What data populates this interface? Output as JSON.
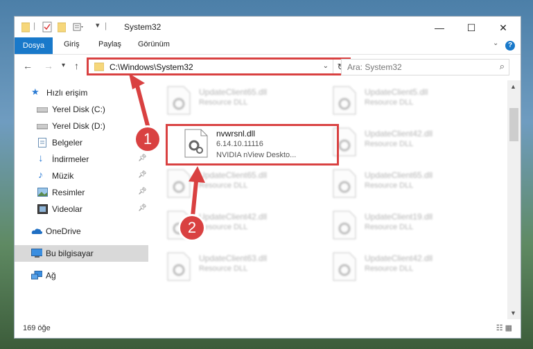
{
  "window": {
    "title": "System32"
  },
  "ribbon": {
    "file_tab": "Dosya",
    "tabs": [
      "Giriş",
      "Paylaş",
      "Görünüm"
    ],
    "help": "?"
  },
  "navigation": {
    "address": "C:\\Windows\\System32",
    "search_placeholder": "Ara: System32"
  },
  "sidebar": {
    "items": [
      {
        "label": "Hızlı erişim",
        "icon": "star-icon"
      },
      {
        "label": "Yerel Disk (C:)",
        "icon": "drive-icon"
      },
      {
        "label": "Yerel Disk (D:)",
        "icon": "drive-icon"
      },
      {
        "label": "Belgeler",
        "icon": "documents-icon",
        "pinned": true
      },
      {
        "label": "İndirmeler",
        "icon": "download-icon",
        "pinned": true
      },
      {
        "label": "Müzik",
        "icon": "music-icon",
        "pinned": true
      },
      {
        "label": "Resimler",
        "icon": "pictures-icon",
        "pinned": true
      },
      {
        "label": "Videolar",
        "icon": "videos-icon",
        "pinned": true
      },
      {
        "label": "OneDrive",
        "icon": "cloud-icon"
      },
      {
        "label": "Bu bilgisayar",
        "icon": "computer-icon",
        "selected": true
      },
      {
        "label": "Ağ",
        "icon": "network-icon"
      }
    ]
  },
  "files": {
    "highlighted": {
      "name": "nvwrsnl.dll",
      "version": "6.14.10.11116",
      "description": "NVIDIA nView Deskto..."
    },
    "blurred": [
      {
        "name": "UpdateClient65.dll",
        "type": "Resource DLL"
      },
      {
        "name": "UpdateClient5.dll",
        "type": "Resource DLL"
      },
      {
        "name": "UpdateClient42.dll",
        "type": "Resource DLL"
      },
      {
        "name": "UpdateClient65.dll",
        "type": "Resource DLL"
      },
      {
        "name": "UpdateClient65.dll",
        "type": "Resource DLL"
      },
      {
        "name": "UpdateClient42.dll",
        "type": "Resource DLL"
      },
      {
        "name": "UpdateClient19.dll",
        "type": "Resource DLL"
      },
      {
        "name": "UpdateClient63.dll",
        "type": "Resource DLL"
      },
      {
        "name": "UpdateClient42.dll",
        "type": "Resource DLL"
      }
    ]
  },
  "status": {
    "item_count": "169 öğe"
  },
  "annotations": {
    "step1": "1",
    "step2": "2",
    "color": "#d94141"
  }
}
